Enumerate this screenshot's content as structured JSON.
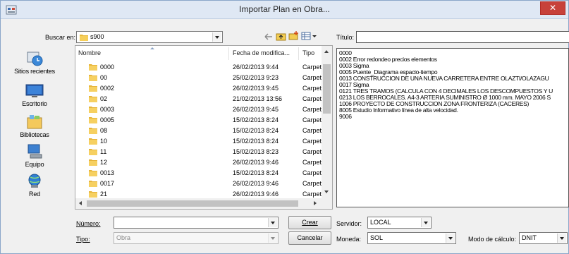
{
  "window": {
    "title": "Importar Plan en Obra...",
    "close_glyph": "✕"
  },
  "toolbar": {
    "lookin_label": "Buscar en:",
    "lookin_value": "s900",
    "titulo_label": "Título:",
    "titulo_value": ""
  },
  "places": [
    {
      "label": "Sitios recientes",
      "icon": "recent-places-icon"
    },
    {
      "label": "Escritorio",
      "icon": "desktop-icon"
    },
    {
      "label": "Bibliotecas",
      "icon": "libraries-icon"
    },
    {
      "label": "Equipo",
      "icon": "computer-icon"
    },
    {
      "label": "Red",
      "icon": "network-icon"
    }
  ],
  "file_list": {
    "columns": [
      "Nombre",
      "Fecha de modifica...",
      "Tipo"
    ],
    "rows": [
      {
        "name": "0000",
        "date": "26/02/2013 9:44",
        "type": "Carpet"
      },
      {
        "name": "00",
        "date": "25/02/2013 9:23",
        "type": "Carpet"
      },
      {
        "name": "0002",
        "date": "26/02/2013 9:45",
        "type": "Carpet"
      },
      {
        "name": "02",
        "date": "21/02/2013 13:56",
        "type": "Carpet"
      },
      {
        "name": "0003",
        "date": "26/02/2013 9:45",
        "type": "Carpet"
      },
      {
        "name": "0005",
        "date": "15/02/2013 8:24",
        "type": "Carpet"
      },
      {
        "name": "08",
        "date": "15/02/2013 8:24",
        "type": "Carpet"
      },
      {
        "name": "10",
        "date": "15/02/2013 8:24",
        "type": "Carpet"
      },
      {
        "name": "11",
        "date": "15/02/2013 8:23",
        "type": "Carpet"
      },
      {
        "name": "12",
        "date": "26/02/2013 9:46",
        "type": "Carpet"
      },
      {
        "name": "0013",
        "date": "15/02/2013 8:24",
        "type": "Carpet"
      },
      {
        "name": "0017",
        "date": "26/02/2013 9:46",
        "type": "Carpet"
      },
      {
        "name": "21",
        "date": "26/02/2013 9:46",
        "type": "Carpet"
      }
    ]
  },
  "description_lines": [
    "0000",
    "0002 Error redondeo precios elementos",
    "0003 Sigma",
    "0005 Puente_Diagrama espacio-tiempo",
    "0013 CONSTRUCCION DE UNA NUEVA CARRETERA ENTRE OLAZTI/OLAZAGU",
    "0017 Sigma",
    "0121 TRES TRAMOS (CALCULA CON 4 DECIMALES LOS DESCOMPUESTOS Y U",
    "0213 LOS BERROCALES. A4-3 ARTERIA SUMINISTRO  Ø 1000 mm. MAYO 2006 S",
    "1006 PROYECTO DE CONSTRUCCION ZONA FRONTERIZA (CACERES)",
    "8005 Estudio Informativo línea de alta velocidad.",
    "9006"
  ],
  "bottom": {
    "numero_label": "Número:",
    "numero_value": "",
    "tipo_label": "Tipo:",
    "tipo_value": "Obra",
    "crear_label": "Crear",
    "cancelar_label": "Cancelar",
    "servidor_label": "Servidor:",
    "servidor_value": "LOCAL",
    "moneda_label": "Moneda:",
    "moneda_value": "SOL",
    "modo_label": "Modo de cálculo:",
    "modo_value": "DNIT"
  }
}
